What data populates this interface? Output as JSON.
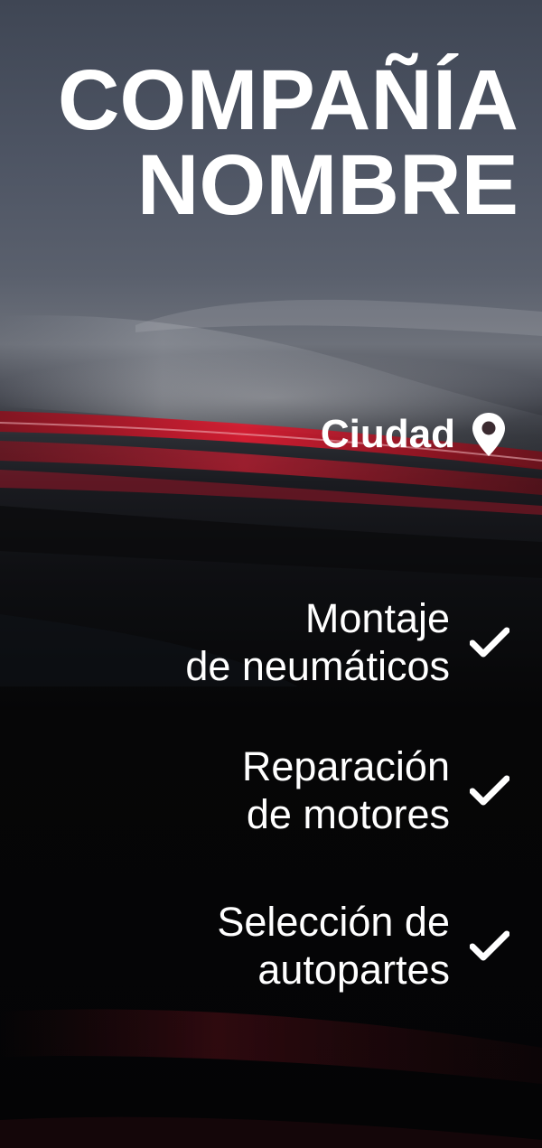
{
  "company": {
    "title_line_1": "COMPAÑÍA",
    "title_line_2": "NOMBRE"
  },
  "location": {
    "city": "Ciudad",
    "icon": "location-pin-icon"
  },
  "services": [
    {
      "line_1": "Montaje",
      "line_2": "de neumáticos",
      "icon": "checkmark-icon"
    },
    {
      "line_1": "Reparación",
      "line_2": "de motores",
      "icon": "checkmark-icon"
    },
    {
      "line_1": "Selección de",
      "line_2": "autopartes",
      "icon": "checkmark-icon"
    }
  ],
  "colors": {
    "text": "#ffffff",
    "accent_red": "#c0182a",
    "background_top": "#4e5564",
    "background_bottom": "#050507"
  }
}
